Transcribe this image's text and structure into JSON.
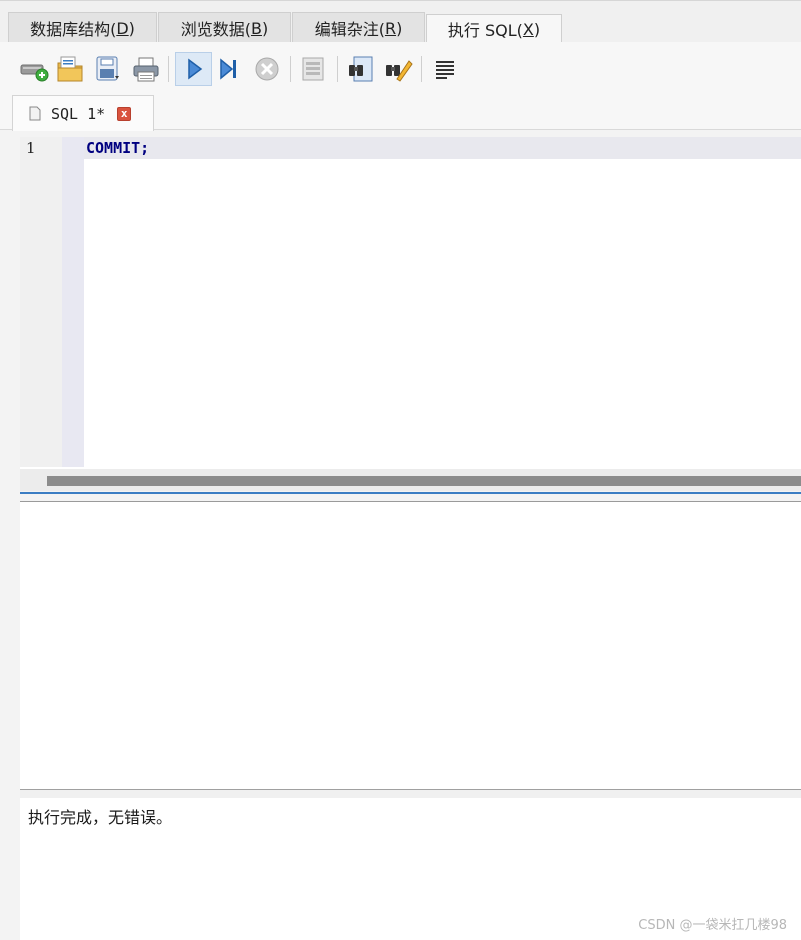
{
  "tabs": [
    {
      "label": "数据库结构(",
      "key": "D",
      "suffix": ")"
    },
    {
      "label": "浏览数据(",
      "key": "B",
      "suffix": ")"
    },
    {
      "label": "编辑杂注(",
      "key": "R",
      "suffix": ")"
    },
    {
      "label": "执行 SQL(",
      "key": "X",
      "suffix": ")"
    }
  ],
  "active_tab": "执行 SQL(X)",
  "toolbar": {
    "buttons": [
      "open-tab-icon",
      "open-sql-file-icon",
      "save-sql-file-icon",
      "print-icon",
      "execute-all-icon",
      "execute-current-line-icon",
      "stop-execution-icon",
      "save-results-icon",
      "find-icon",
      "find-replace-icon",
      "comment-icon"
    ]
  },
  "editor_tab": {
    "label": "SQL 1*",
    "close": "x"
  },
  "editor": {
    "lines": [
      {
        "number": "1",
        "code": "COMMIT;"
      }
    ]
  },
  "message": "执行完成，无错误。",
  "watermark": "CSDN @一袋米扛几楼98",
  "colors": {
    "keyword": "#000080",
    "splitter": "#3b7dc3",
    "close": "#d9533e"
  }
}
